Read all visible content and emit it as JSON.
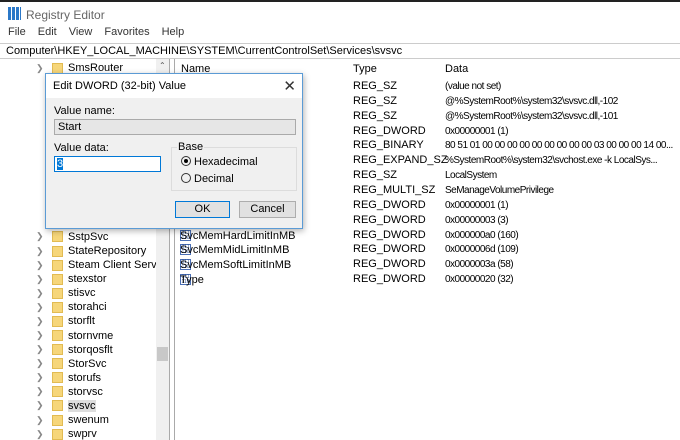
{
  "window": {
    "title": "Registry Editor",
    "menu": [
      "File",
      "Edit",
      "View",
      "Favorites",
      "Help"
    ],
    "address": "Computer\\HKEY_LOCAL_MACHINE\\SYSTEM\\CurrentControlSet\\Services\\svsvc"
  },
  "tree": {
    "items": [
      {
        "label": "SmsRouter",
        "row": 0
      },
      {
        "label": "SstpSvc",
        "row": 12
      },
      {
        "label": "StateRepository",
        "row": 13
      },
      {
        "label": "Steam Client Service",
        "row": 14
      },
      {
        "label": "stexstor",
        "row": 15
      },
      {
        "label": "stisvc",
        "row": 16
      },
      {
        "label": "storahci",
        "row": 17
      },
      {
        "label": "storflt",
        "row": 18
      },
      {
        "label": "stornvme",
        "row": 19
      },
      {
        "label": "storqosflt",
        "row": 20
      },
      {
        "label": "StorSvc",
        "row": 21
      },
      {
        "label": "storufs",
        "row": 22
      },
      {
        "label": "storvsc",
        "row": 23
      },
      {
        "label": "svsvc",
        "row": 24,
        "selected": true
      },
      {
        "label": "swenum",
        "row": 25
      },
      {
        "label": "swprv",
        "row": 26
      }
    ]
  },
  "list": {
    "headers": {
      "name": "Name",
      "type": "Type",
      "data": "Data"
    },
    "rows": [
      {
        "name": "",
        "type": "REG_SZ",
        "data": "(value not set)"
      },
      {
        "name": "",
        "type": "REG_SZ",
        "data": "@%SystemRoot%\\system32\\svsvc.dll,-102"
      },
      {
        "name": "",
        "type": "REG_SZ",
        "data": "@%SystemRoot%\\system32\\svsvc.dll,-101"
      },
      {
        "name": "",
        "type": "REG_DWORD",
        "data": "0x00000001 (1)"
      },
      {
        "name": "",
        "type": "REG_BINARY",
        "data": "80 51 01 00 00 00 00 00 00 00 00 00 03 00 00 00 14 00..."
      },
      {
        "name": "",
        "type": "REG_EXPAND_SZ",
        "data": "%SystemRoot%\\system32\\svchost.exe -k LocalSys..."
      },
      {
        "name": "",
        "type": "REG_SZ",
        "data": "LocalSystem"
      },
      {
        "name": "",
        "type": "REG_MULTI_SZ",
        "data": "SeManageVolumePrivilege"
      },
      {
        "name": "",
        "type": "REG_DWORD",
        "data": "0x00000001 (1)"
      },
      {
        "name": "",
        "type": "REG_DWORD",
        "data": "0x00000003 (3)"
      },
      {
        "name": "SvcMemHardLimitInMB",
        "type": "REG_DWORD",
        "data": "0x000000a0 (160)"
      },
      {
        "name": "SvcMemMidLimitInMB",
        "type": "REG_DWORD",
        "data": "0x0000006d (109)"
      },
      {
        "name": "SvcMemSoftLimitInMB",
        "type": "REG_DWORD",
        "data": "0x0000003a (58)"
      },
      {
        "name": "Type",
        "type": "REG_DWORD",
        "data": "0x00000020 (32)"
      }
    ]
  },
  "dialog": {
    "title": "Edit DWORD (32-bit) Value",
    "value_name_label": "Value name:",
    "value_name": "Start",
    "value_data_label": "Value data:",
    "value_data": "3",
    "base_label": "Base",
    "hex_label": "Hexadecimal",
    "dec_label": "Decimal",
    "selected_base": "Hexadecimal",
    "ok": "OK",
    "cancel": "Cancel"
  }
}
